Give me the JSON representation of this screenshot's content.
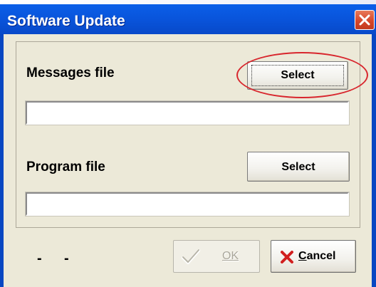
{
  "window": {
    "title": "Software Update",
    "close_icon": "close-icon"
  },
  "messages": {
    "label": "Messages file",
    "select_label": "Select",
    "file_value": ""
  },
  "program": {
    "label": "Program file",
    "select_label": "Select",
    "file_value": ""
  },
  "status": {
    "dash1": "-",
    "dash2": "-"
  },
  "buttons": {
    "ok_label": "OK",
    "ok_enabled": false,
    "cancel_label": "Cancel"
  },
  "colors": {
    "title_bar": "#0a5de6",
    "annotation_ring": "#d8262d",
    "cancel_icon": "#d11f1f"
  }
}
